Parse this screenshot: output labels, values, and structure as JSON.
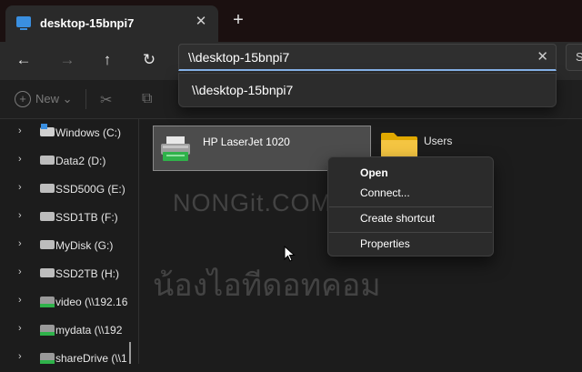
{
  "window": {
    "tab_title": "desktop-15bnpi7",
    "tab_close": "✕",
    "new_tab": "+"
  },
  "nav": {
    "back": "←",
    "forward": "→",
    "up": "↑",
    "refresh": "↻",
    "address_value": "\\\\desktop-15bnpi7",
    "address_clear": "✕",
    "search_stub": "S"
  },
  "suggestion": {
    "item": "\\\\desktop-15bnpi7"
  },
  "toolbar": {
    "new_label": "New",
    "new_chevron": "⌄",
    "cut_icon": "✂",
    "copy_icon": "⧉"
  },
  "sidebar": {
    "chevron": "›",
    "items": [
      {
        "label": "Windows (C:)",
        "icon": "windows-drive-icon"
      },
      {
        "label": "Data2 (D:)",
        "icon": "drive-icon"
      },
      {
        "label": "SSD500G (E:)",
        "icon": "drive-icon"
      },
      {
        "label": "SSD1TB (F:)",
        "icon": "drive-icon"
      },
      {
        "label": "MyDisk (G:)",
        "icon": "drive-icon"
      },
      {
        "label": "SSD2TB (H:)",
        "icon": "drive-icon"
      },
      {
        "label": "video (\\\\192.16",
        "icon": "network-drive-icon"
      },
      {
        "label": "mydata (\\\\192",
        "icon": "network-drive-icon"
      },
      {
        "label": "shareDrive (\\\\1",
        "icon": "network-drive-icon"
      }
    ]
  },
  "content": {
    "printer_label": "HP LaserJet 1020",
    "folder_label": "Users"
  },
  "context_menu": {
    "open": "Open",
    "connect": "Connect...",
    "create_shortcut": "Create shortcut",
    "properties": "Properties"
  },
  "watermark": {
    "line1": "NONGit.COM",
    "line2": "น้องไอทีดอทคอม"
  },
  "colors": {
    "accent": "#8ab8f0",
    "background": "#1c1c1c",
    "folder": "#f4c542",
    "printer_led": "#2fb24a"
  }
}
